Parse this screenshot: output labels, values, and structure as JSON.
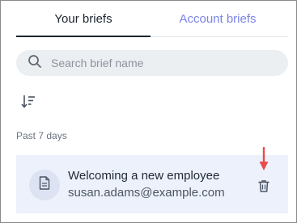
{
  "tabs": [
    {
      "label": "Your briefs",
      "active": true
    },
    {
      "label": "Account briefs",
      "active": false
    }
  ],
  "search": {
    "placeholder": "Search brief name",
    "value": "",
    "icon": "search-icon"
  },
  "sort": {
    "icon": "sort-descending-icon"
  },
  "section": {
    "label": "Past 7 days"
  },
  "briefs": [
    {
      "title": "Welcoming a new employee",
      "email": "susan.adams@example.com",
      "icon": "document-icon",
      "action_icon": "trash-icon"
    }
  ],
  "annotation": {
    "icon": "down-arrow-icon",
    "color": "#e84c4c"
  },
  "colors": {
    "accent": "#7b83e6",
    "active_tab": "#1c2430",
    "card_bg": "#edf1fb"
  }
}
